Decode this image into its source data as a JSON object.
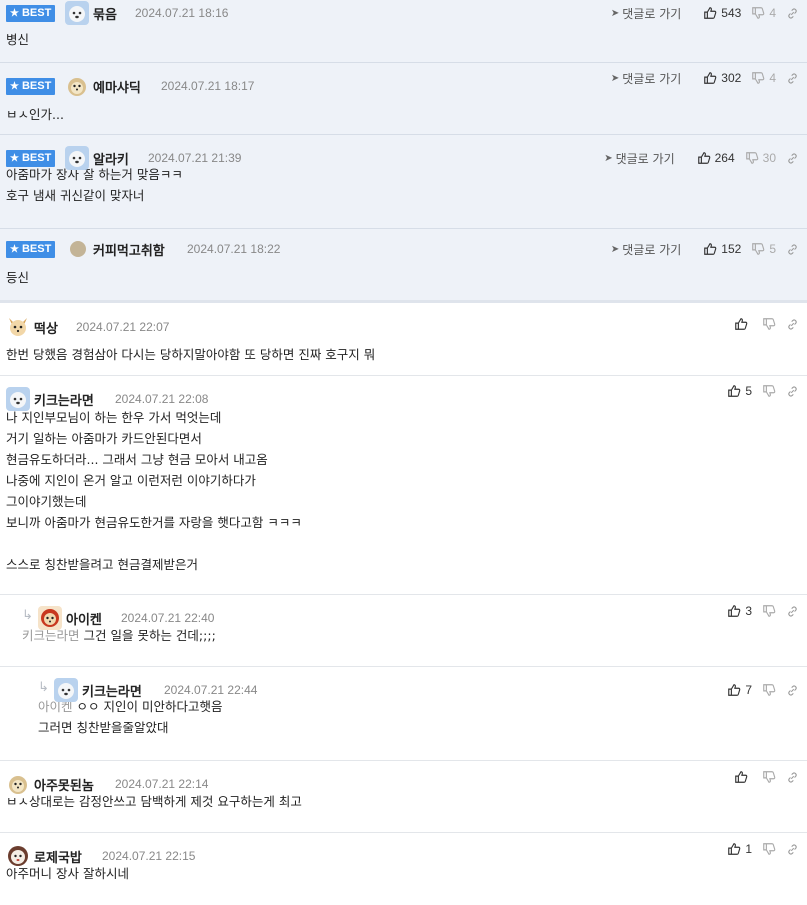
{
  "best_badge": "BEST",
  "goto_label": "댓글로 가기",
  "comments": [
    {
      "nick": "묶음",
      "date": "2024.07.21 18:16",
      "up": "543",
      "down": "4",
      "lines": [
        "병신"
      ]
    },
    {
      "nick": "예마샤딕",
      "date": "2024.07.21 18:17",
      "up": "302",
      "down": "4",
      "lines": [
        "ㅂㅅ인가..."
      ]
    },
    {
      "nick": "알라키",
      "date": "2024.07.21 21:39",
      "up": "264",
      "down": "30",
      "lines": [
        "아줌마가 장사 잘 하는거 맞음ㅋㅋ",
        "호구 냄새 귀신같이 맞자너"
      ]
    },
    {
      "nick": "커피먹고취함",
      "date": "2024.07.21 18:22",
      "up": "152",
      "down": "5",
      "lines": [
        "등신"
      ]
    },
    {
      "nick": "떡상",
      "date": "2024.07.21 22:07",
      "up": "",
      "lines": [
        "한번 당했음 경험삼아 다시는 당하지말아야함 또 당하면 진짜 호구지 뭐"
      ]
    },
    {
      "nick": "키크는라면",
      "date": "2024.07.21 22:08",
      "up": "5",
      "lines": [
        "나 지인부모님이 하는 한우 가서 먹엇는데",
        "거기 일하는 아줌마가 카드안된다면서",
        "현금유도하더라... 그래서 그냥 현금 모아서 내고옴",
        "나중에 지인이 온거 알고 이런저런 이야기하다가",
        "그이야기했는데",
        "보니까 아줌마가 현금유도한거를 자랑을 햇다고함 ㅋㅋㅋ",
        "",
        "스스로 칭찬받을려고 현금결제받은거"
      ]
    },
    {
      "nick": "아이켄",
      "date": "2024.07.21 22:40",
      "up": "3",
      "mention": "키크는라면",
      "lines": [
        "그건 일을 못하는 건데;;;;"
      ]
    },
    {
      "nick": "키크는라면",
      "date": "2024.07.21 22:44",
      "up": "7",
      "mention": "아이켄",
      "lines": [
        "ㅇㅇ 지인이 미안하다고햇음",
        "그러면 칭찬받을줄알았대"
      ]
    },
    {
      "nick": "아주못된놈",
      "date": "2024.07.21 22:14",
      "up": "",
      "lines": [
        "ㅂㅅ상대로는 감정안쓰고 담백하게 제것 요구하는게 최고"
      ]
    },
    {
      "nick": "로제국밥",
      "date": "2024.07.21 22:15",
      "up": "1",
      "lines": [
        "아주머니 장사 잘하시네"
      ]
    }
  ]
}
